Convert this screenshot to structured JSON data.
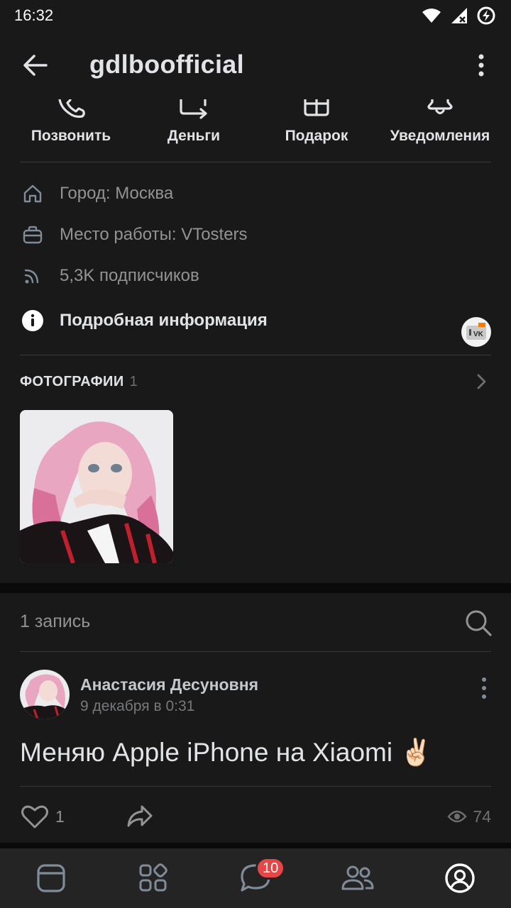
{
  "status_bar": {
    "time": "16:32",
    "icons": [
      "wifi-icon",
      "signal-icon",
      "battery-charging-icon"
    ]
  },
  "header": {
    "title": "gdlboofficial",
    "back_icon": "arrow-left-icon",
    "more_icon": "more-vertical-icon"
  },
  "actions": [
    {
      "label": "Позвонить",
      "icon": "phone-icon"
    },
    {
      "label": "Деньги",
      "icon": "money-transfer-icon"
    },
    {
      "label": "Подарок",
      "icon": "gift-icon"
    },
    {
      "label": "Уведомления",
      "icon": "bell-icon"
    }
  ],
  "info": {
    "city": "Город: Москва",
    "work": "Место работы: VTosters",
    "work_logo_icon": "vtosters-logo-icon",
    "followers": "5,3K подписчиков",
    "details": "Подробная информация"
  },
  "photos": {
    "title": "ФОТОГРАФИИ",
    "count": "1"
  },
  "wall": {
    "title": "1 запись",
    "post": {
      "author": "Анастасия Десуновня",
      "date": "9 декабря в 0:31",
      "text": "Меняю Apple iPhone на Xiaomi ✌🏻",
      "likes": "1",
      "views": "74"
    }
  },
  "tabbar": {
    "tabs": [
      "news-tab",
      "services-tab",
      "messages-tab",
      "friends-tab",
      "profile-tab"
    ],
    "messages_badge": "10",
    "active": "profile-tab"
  },
  "colors": {
    "background": "#19191a",
    "separator_bg": "#0a0a0a",
    "text_primary": "#e1e3e6",
    "text_secondary": "#939393",
    "badge": "#e64646",
    "tabbar": "#242425"
  }
}
